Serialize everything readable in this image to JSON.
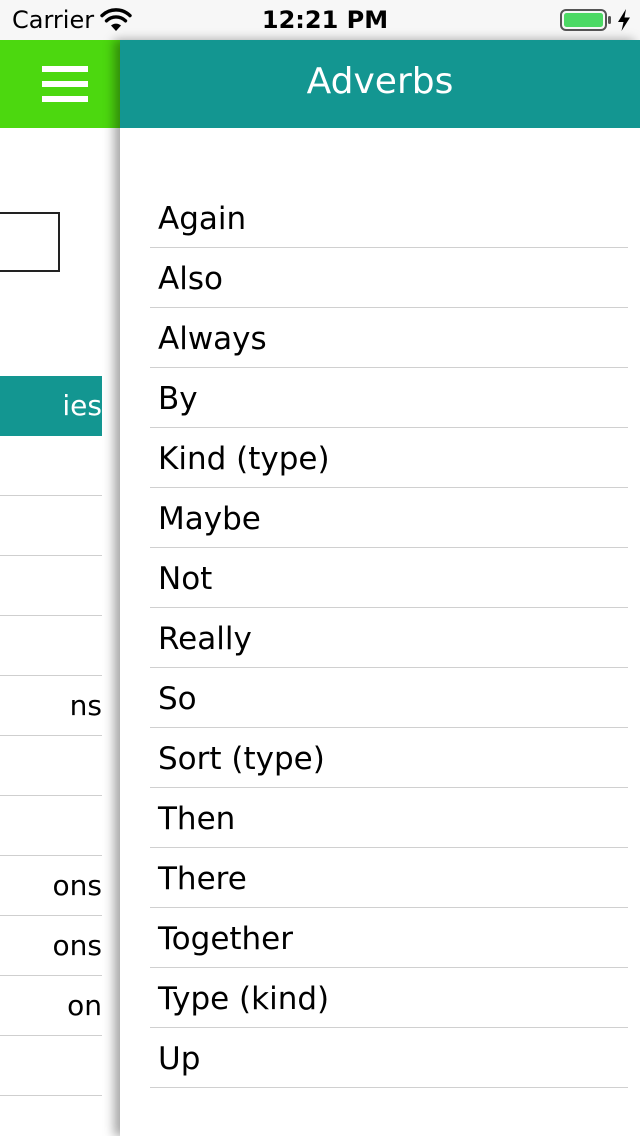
{
  "status_bar": {
    "carrier": "Carrier",
    "time": "12:21 PM",
    "battery_color": "#4cd964"
  },
  "menu": {
    "header_color": "#4cd80f",
    "active_color": "#139691",
    "items": [
      {
        "label": "ies",
        "active": true
      },
      {
        "label": ""
      },
      {
        "label": ""
      },
      {
        "label": ""
      },
      {
        "label": ""
      },
      {
        "label": "ns"
      },
      {
        "label": ""
      },
      {
        "label": ""
      },
      {
        "label": "ons"
      },
      {
        "label": "ons"
      },
      {
        "label": "on"
      },
      {
        "label": ""
      }
    ]
  },
  "main": {
    "title": "Adverbs",
    "header_color": "#139691",
    "words": [
      "Again",
      "Also",
      "Always",
      "By",
      "Kind (type)",
      "Maybe",
      "Not",
      "Really",
      "So",
      "Sort (type)",
      "Then",
      "There",
      "Together",
      "Type (kind)",
      "Up"
    ]
  }
}
